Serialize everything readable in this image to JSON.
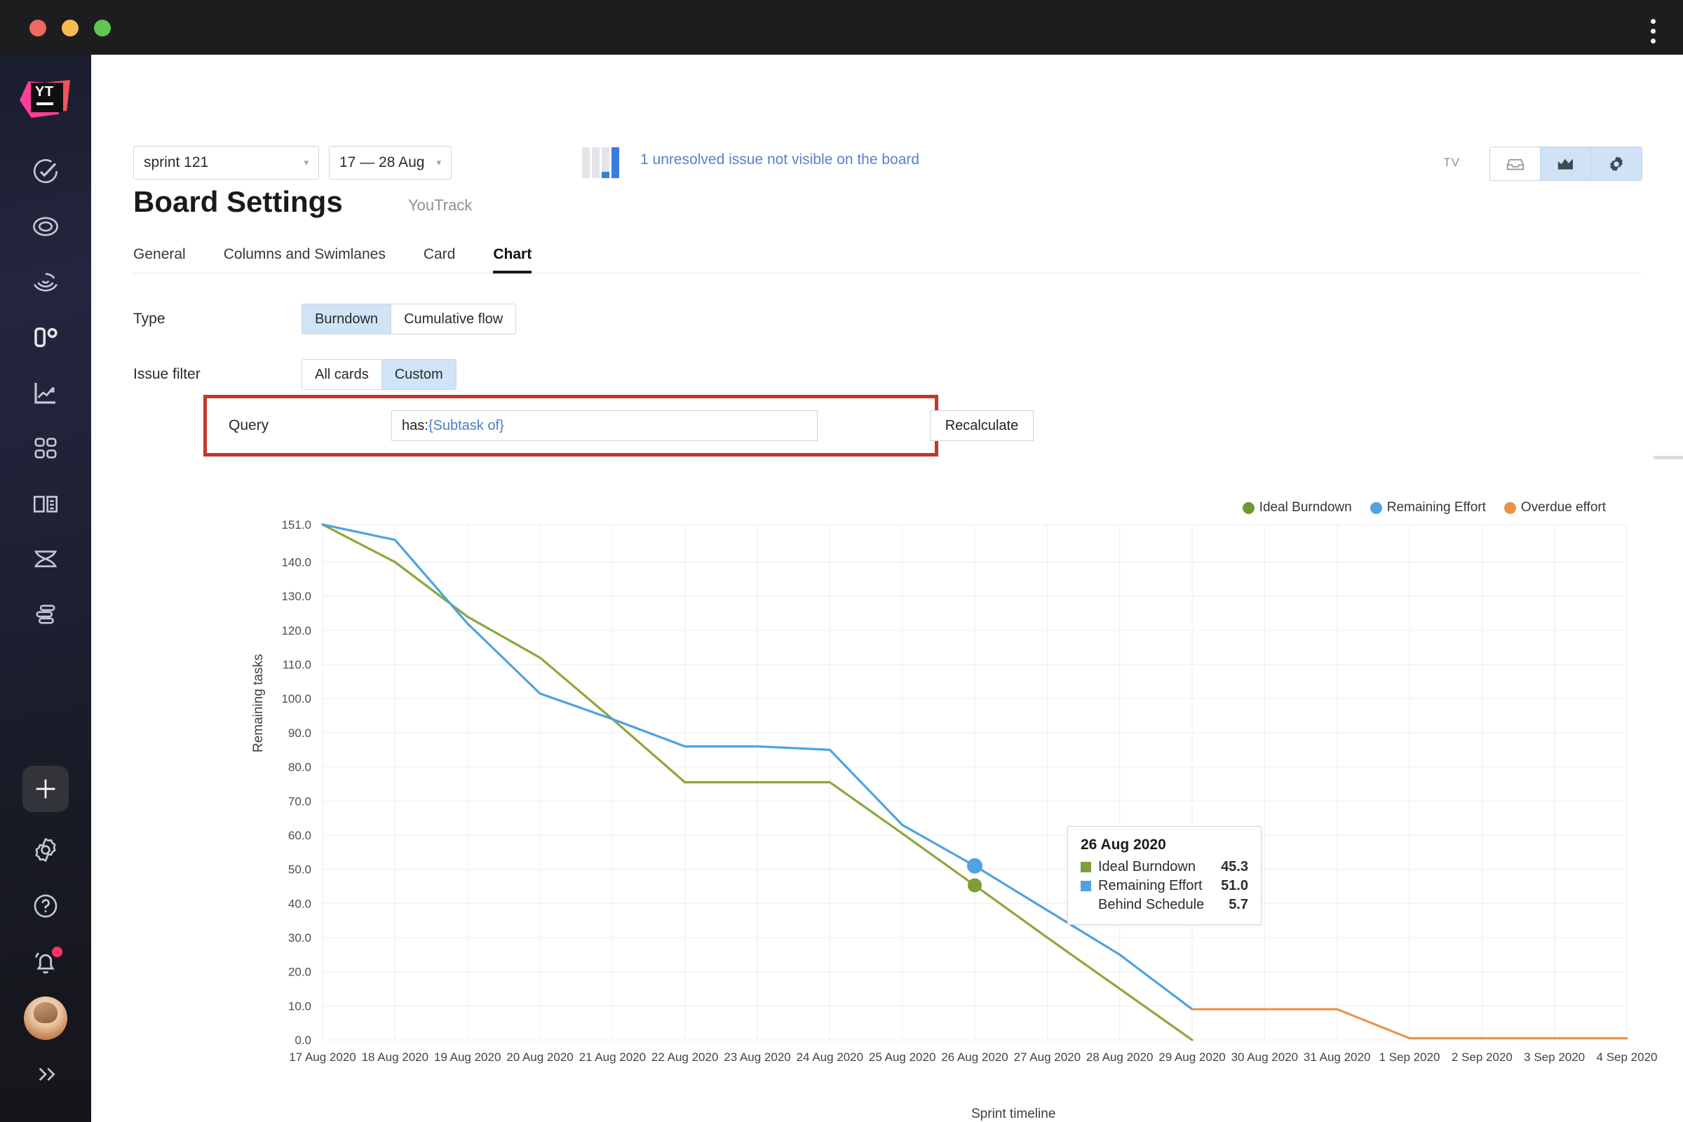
{
  "window": {
    "traffic_lights": [
      "close",
      "minimize",
      "maximize"
    ],
    "menu_icon": "kebab-menu-icon"
  },
  "sidebar": {
    "logo": "YT",
    "items": [
      {
        "name": "issues",
        "icon": "check-circle-icon"
      },
      {
        "name": "projects",
        "icon": "target-icon"
      },
      {
        "name": "activity",
        "icon": "ripple-icon"
      },
      {
        "name": "agile-boards",
        "icon": "zero-degree-icon"
      },
      {
        "name": "reports",
        "icon": "chart-trend-icon"
      },
      {
        "name": "dashboards",
        "icon": "grid-icon"
      },
      {
        "name": "knowledge-base",
        "icon": "book-icon"
      },
      {
        "name": "workflows",
        "icon": "hourglass-icon"
      },
      {
        "name": "timesheets",
        "icon": "layers-icon"
      }
    ],
    "bottom": [
      {
        "name": "add",
        "icon": "plus-icon"
      },
      {
        "name": "settings",
        "icon": "gear-icon"
      },
      {
        "name": "help",
        "icon": "question-circle-icon"
      },
      {
        "name": "notifications",
        "icon": "bell-icon",
        "badge": true
      },
      {
        "name": "profile",
        "icon": "avatar"
      },
      {
        "name": "expand",
        "icon": "double-chevron-right-icon"
      }
    ]
  },
  "topbar": {
    "sprint_select": "sprint 121",
    "date_select": "17 — 28 Aug",
    "unresolved_note": "1 unresolved issue not visible on the board",
    "tv_label": "TV",
    "buttons": [
      {
        "name": "board-view-button",
        "icon": "board-icon",
        "active": false
      },
      {
        "name": "chart-view-button",
        "icon": "chart-icon",
        "active": true
      },
      {
        "name": "settings-button",
        "icon": "gear-icon",
        "active": true
      }
    ]
  },
  "page": {
    "title": "Board Settings",
    "subtitle": "YouTrack",
    "tabs": [
      {
        "label": "General",
        "active": false
      },
      {
        "label": "Columns and Swimlanes",
        "active": false
      },
      {
        "label": "Card",
        "active": false
      },
      {
        "label": "Chart",
        "active": true
      }
    ]
  },
  "settings": {
    "type": {
      "label": "Type",
      "options": [
        {
          "label": "Burndown",
          "selected": true
        },
        {
          "label": "Cumulative flow",
          "selected": false
        }
      ]
    },
    "issue_filter": {
      "label": "Issue filter",
      "options": [
        {
          "label": "All cards",
          "selected": false
        },
        {
          "label": "Custom",
          "selected": true
        }
      ]
    },
    "query": {
      "label": "Query",
      "value_prefix": "has: ",
      "value_token": "{Subtask of}",
      "recalculate_label": "Recalculate",
      "highlight_color": "#c0392b"
    }
  },
  "chart_data": {
    "type": "line",
    "title": "",
    "xlabel": "Sprint timeline",
    "ylabel": "Remaining tasks",
    "ylim": [
      0,
      151
    ],
    "grid": true,
    "legend_position": "top-right",
    "y_ticks": [
      "0.0",
      "10.0",
      "20.0",
      "30.0",
      "40.0",
      "50.0",
      "60.0",
      "70.0",
      "80.0",
      "90.0",
      "100.0",
      "110.0",
      "120.0",
      "130.0",
      "140.0",
      "151.0"
    ],
    "categories": [
      "17 Aug 2020",
      "18 Aug 2020",
      "19 Aug 2020",
      "20 Aug 2020",
      "21 Aug 2020",
      "22 Aug 2020",
      "23 Aug 2020",
      "24 Aug 2020",
      "25 Aug 2020",
      "26 Aug 2020",
      "27 Aug 2020",
      "28 Aug 2020",
      "29 Aug 2020",
      "30 Aug 2020",
      "31 Aug 2020",
      "1 Sep 2020",
      "2 Sep 2020",
      "3 Sep 2020",
      "4 Sep 2020"
    ],
    "series": [
      {
        "name": "Ideal Burndown",
        "color": "#8ba83b",
        "values": [
          151.0,
          140.0,
          124.0,
          112.0,
          94.0,
          75.5,
          75.5,
          75.5,
          60.5,
          45.3,
          30.0,
          15.0,
          0.0,
          null,
          null,
          null,
          null,
          null,
          null
        ]
      },
      {
        "name": "Remaining Effort",
        "color": "#4ea3e0",
        "values": [
          151.0,
          146.5,
          122.0,
          101.5,
          94.0,
          86.0,
          86.0,
          85.0,
          63.0,
          51.0,
          38.0,
          25.0,
          9.0,
          null,
          null,
          null,
          null,
          null,
          null
        ]
      },
      {
        "name": "Overdue effort",
        "color": "#e8934a",
        "values": [
          null,
          null,
          null,
          null,
          null,
          null,
          null,
          null,
          null,
          null,
          null,
          null,
          9.0,
          9.0,
          9.0,
          0.5,
          0.5,
          0.5,
          0.5
        ]
      }
    ],
    "legend": [
      {
        "label": "Ideal Burndown",
        "color": "#6f9a33"
      },
      {
        "label": "Remaining Effort",
        "color": "#4ea3e0"
      },
      {
        "label": "Overdue effort",
        "color": "#e8934a"
      }
    ],
    "tooltip": {
      "date": "26 Aug 2020",
      "rows": [
        {
          "label": "Ideal Burndown",
          "value": "45.3",
          "color": "#7d9e38"
        },
        {
          "label": "Remaining Effort",
          "value": "51.0",
          "color": "#4ea3e0"
        },
        {
          "label": "Behind Schedule",
          "value": "5.7",
          "color": null
        }
      ]
    }
  }
}
